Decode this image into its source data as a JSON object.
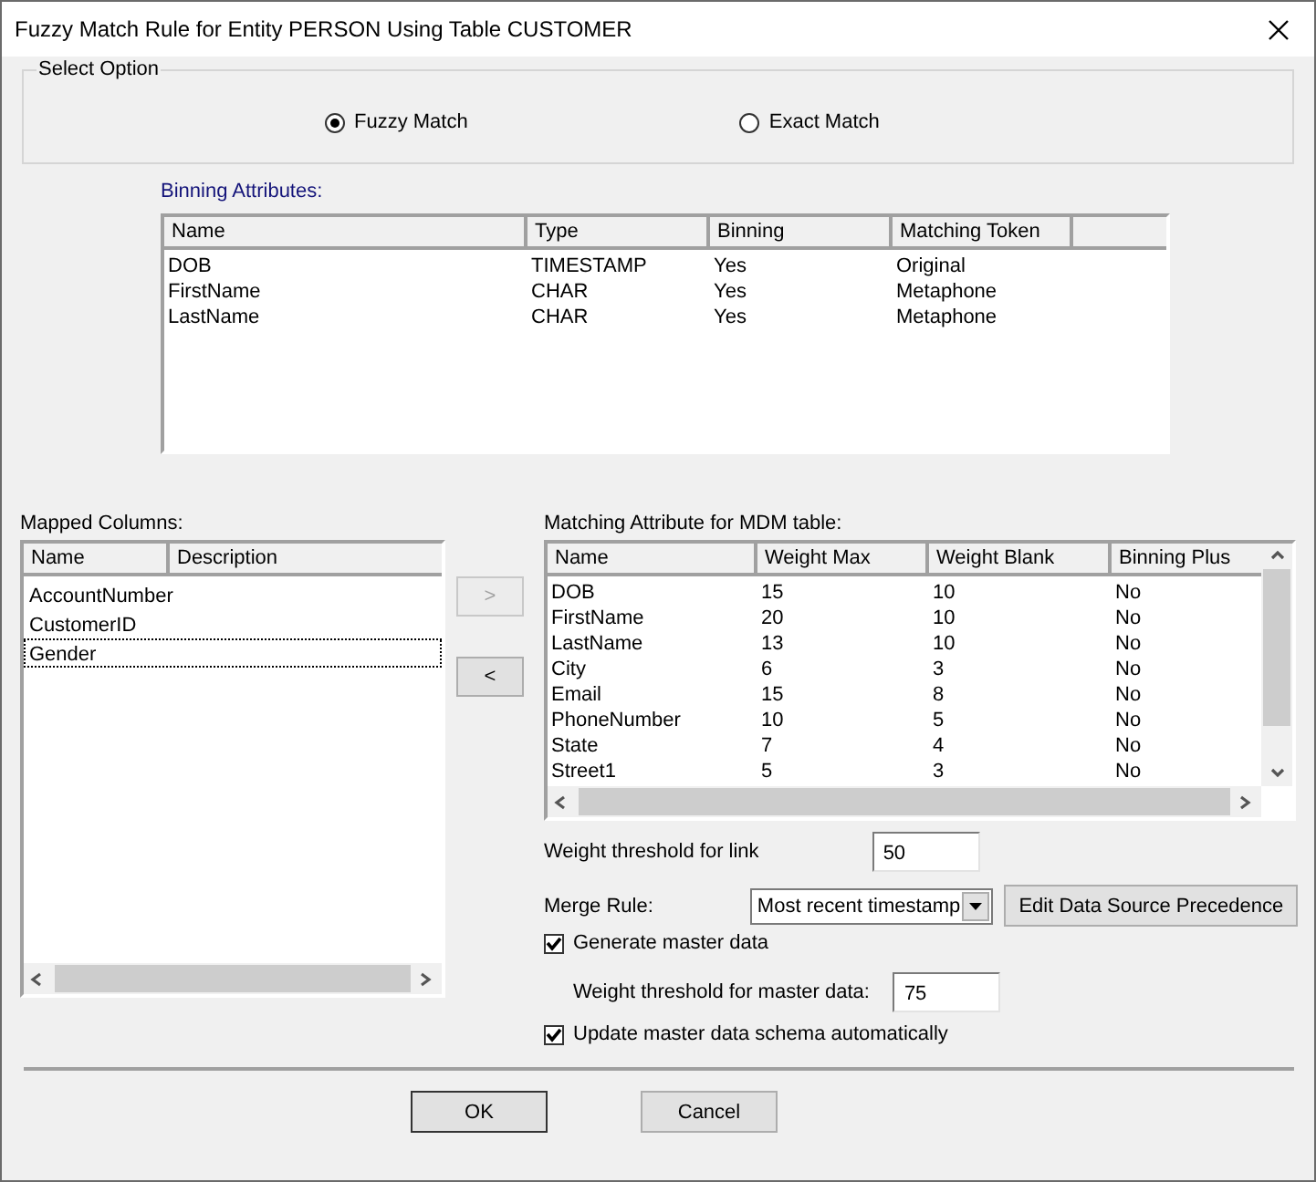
{
  "window": {
    "title": "Fuzzy Match Rule for Entity PERSON Using Table CUSTOMER"
  },
  "select_option": {
    "label": "Select Option",
    "options": [
      {
        "label": "Fuzzy Match",
        "selected": true
      },
      {
        "label": "Exact Match",
        "selected": false
      }
    ]
  },
  "binning_attributes": {
    "label": "Binning Attributes:",
    "columns": [
      "Name",
      "Type",
      "Binning",
      "Matching Token"
    ],
    "rows": [
      [
        "DOB",
        "TIMESTAMP",
        "Yes",
        "Original"
      ],
      [
        "FirstName",
        "CHAR",
        "Yes",
        "Metaphone"
      ],
      [
        "LastName",
        "CHAR",
        "Yes",
        "Metaphone"
      ]
    ]
  },
  "mapped_columns": {
    "label": "Mapped Columns:",
    "columns": [
      "Name",
      "Description"
    ],
    "rows": [
      {
        "name": "AccountNumber",
        "selected": false
      },
      {
        "name": "CustomerID",
        "selected": false
      },
      {
        "name": "Gender",
        "selected": true
      }
    ]
  },
  "move_buttons": [
    {
      "label": ">",
      "disabled": true
    },
    {
      "label": "<",
      "disabled": false
    }
  ],
  "matching_attributes": {
    "label": "Matching Attribute for MDM table:",
    "columns": [
      "Name",
      "Weight Max",
      "Weight Blank",
      "Binning Plus"
    ],
    "rows": [
      [
        "DOB",
        "15",
        "10",
        "No"
      ],
      [
        "FirstName",
        "20",
        "10",
        "No"
      ],
      [
        "LastName",
        "13",
        "10",
        "No"
      ],
      [
        "City",
        "6",
        "3",
        "No"
      ],
      [
        "Email",
        "15",
        "8",
        "No"
      ],
      [
        "PhoneNumber",
        "10",
        "5",
        "No"
      ],
      [
        "State",
        "7",
        "4",
        "No"
      ],
      [
        "Street1",
        "5",
        "3",
        "No"
      ]
    ]
  },
  "link_threshold": {
    "label": "Weight threshold for link",
    "value": "50"
  },
  "merge_rule": {
    "label": "Merge Rule:",
    "value": "Most recent timestamp"
  },
  "edit_precedence_button": "Edit Data Source Precedence",
  "generate_master_data": {
    "label": "Generate master data",
    "checked": true
  },
  "master_threshold": {
    "label": "Weight threshold for master data:",
    "value": "75"
  },
  "update_schema": {
    "label": "Update master data schema automatically",
    "checked": true
  },
  "buttons": [
    "OK",
    "Cancel"
  ]
}
